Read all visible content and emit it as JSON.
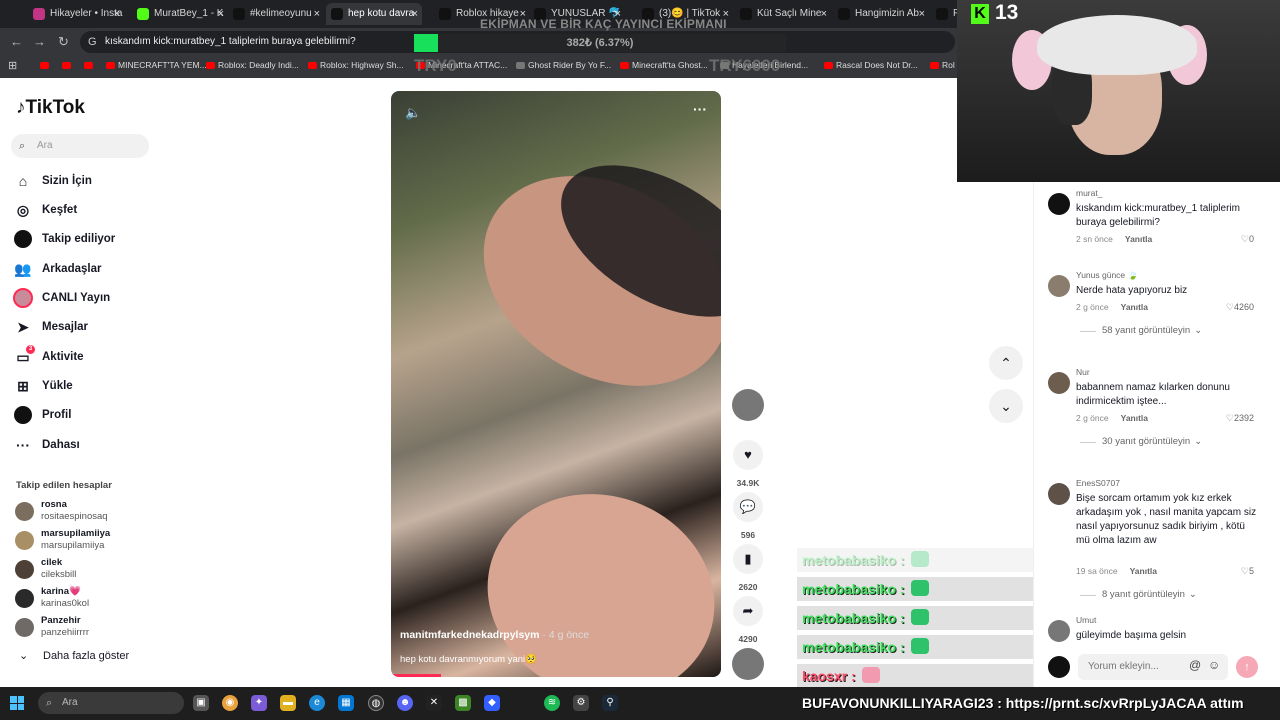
{
  "browser": {
    "tabs": [
      {
        "label": "Hikayeler • Insta",
        "color": "#c13584"
      },
      {
        "label": "MuratBey_1 - K",
        "color": "#53fc18"
      },
      {
        "label": "#kelimeoyunu",
        "color": "#111111"
      },
      {
        "label": "hep kotu davra",
        "color": "#111111"
      },
      {
        "label": "Roblox hikaye",
        "color": "#111111"
      },
      {
        "label": "YUNUSLAR 🐬",
        "color": "#111111"
      },
      {
        "label": "(3)😊 | TikTok",
        "color": "#111111"
      },
      {
        "label": "Küt Saçlı Mine",
        "color": "#111111"
      },
      {
        "label": "Hangimizin Ab",
        "color": "#111111"
      },
      {
        "label": "P",
        "color": "#111111"
      }
    ],
    "address": "kıskandım kick:muratbey_1 taliplerim buraya gelebilirmi?",
    "bookmarks": [
      "",
      "",
      "",
      "MINECRAFT'TA YEM...",
      "Roblox: Deadly Indi...",
      "Roblox: Highway Sh...",
      "Minecraft'ta ATTAC...",
      "Ghost Rider By Yo F...",
      "Minecraft'ta Ghost...",
      "Hayaletleri Birlend...",
      "Rascal Does Not Dr...",
      "Rol Y"
    ]
  },
  "overlay": {
    "title": "EKİPMAN VE BİR KAÇ YAYINCI EKİPMANI",
    "progress_text": "382₺ (6.37%)",
    "progress_fraction": 0.0637,
    "left_total": "TRY0",
    "right_total": "TRY6000"
  },
  "sidebar": {
    "logo": "TikTok",
    "search_placeholder": "Ara",
    "nav": [
      {
        "label": "Sizin İçin",
        "icon": "home-icon",
        "glyph": "⌂"
      },
      {
        "label": "Keşfet",
        "icon": "compass-icon",
        "glyph": "◎"
      },
      {
        "label": "Takip ediliyor",
        "icon": "following-icon",
        "glyph": "●"
      },
      {
        "label": "Arkadaşlar",
        "icon": "friends-icon",
        "glyph": "👥"
      },
      {
        "label": "CANLI Yayın",
        "icon": "live-icon",
        "glyph": ""
      },
      {
        "label": "Mesajlar",
        "icon": "send-icon",
        "glyph": "➤"
      },
      {
        "label": "Aktivite",
        "icon": "activity-icon",
        "glyph": "▭",
        "badge": "3"
      },
      {
        "label": "Yükle",
        "icon": "upload-icon",
        "glyph": "⊞"
      },
      {
        "label": "Profil",
        "icon": "profile-icon",
        "glyph": "●"
      },
      {
        "label": "Dahası",
        "icon": "more-icon",
        "glyph": "···"
      }
    ],
    "following_title": "Takip edilen hesaplar",
    "accounts": [
      {
        "name": "rosna",
        "handle": "rositaespinosaq"
      },
      {
        "name": "marsupilamiiya",
        "handle": "marsupilamiiya"
      },
      {
        "name": "cilek",
        "handle": "cileksbill"
      },
      {
        "name": "karina💗",
        "handle": "karinas0kol"
      },
      {
        "name": "Panzehir",
        "handle": "panzehiirrrr"
      }
    ],
    "show_more": "Daha fazla göster"
  },
  "video": {
    "author": "manitmfarkednekadrpylsym",
    "ago": "· 4 g önce",
    "caption": "hep kotu davranmıyorum yani🥺",
    "progress_fraction": 0.15,
    "likes": "34.9K",
    "comments": "596",
    "saves": "2620",
    "shares": "4290"
  },
  "webcam": {
    "viewers": "13"
  },
  "comments": [
    {
      "user": "murat_",
      "text": "kıskandım kick:muratbey_1 taliplerim buraya gelebilirmi?",
      "time": "2 sn önce",
      "reply": "Yanıtla",
      "likes": "0"
    },
    {
      "user": "Yunus günce 🍃",
      "text": "Nerde hata yapıyoruz biz",
      "time": "2 g önce",
      "reply": "Yanıtla",
      "likes": "4260",
      "more": "58 yanıt görüntüleyin"
    },
    {
      "user": "Nur",
      "text": "babannem namaz kılarken donunu indirmicektim iştee...",
      "time": "2 g önce",
      "reply": "Yanıtla",
      "likes": "2392",
      "more": "30 yanıt görüntüleyin"
    },
    {
      "user": "EnesS0707",
      "text": "Bişe sorcam ortamım yok kız erkek arkadaşım yok , nasıl manita yapcam siz nasıl yapıyorsunuz sadık biriyim , kötü mü olma lazım aw",
      "time": "19 sa önce",
      "reply": "Yanıtla",
      "likes": "5",
      "more": "8 yanıt görüntüleyin"
    },
    {
      "user": "Umut",
      "text": "güleyimde başıma gelsin",
      "time": "",
      "reply": "",
      "likes": ""
    }
  ],
  "comment_input_placeholder": "Yorum ekleyin...",
  "chat": [
    {
      "user": "metobabasiko",
      "faint": true
    },
    {
      "user": "metobabasiko",
      "faint": false
    },
    {
      "user": "metobabasiko",
      "faint": false
    },
    {
      "user": "metobabasiko",
      "faint": false
    },
    {
      "user": "kaosxr",
      "faint": false
    }
  ],
  "chat_separator": " :",
  "taskbar": {
    "search_placeholder": "Ara"
  },
  "ticker": "BUFAVONUNKILLIYARAGI23 : https://prnt.sc/xvRrpLyJACAA attım"
}
